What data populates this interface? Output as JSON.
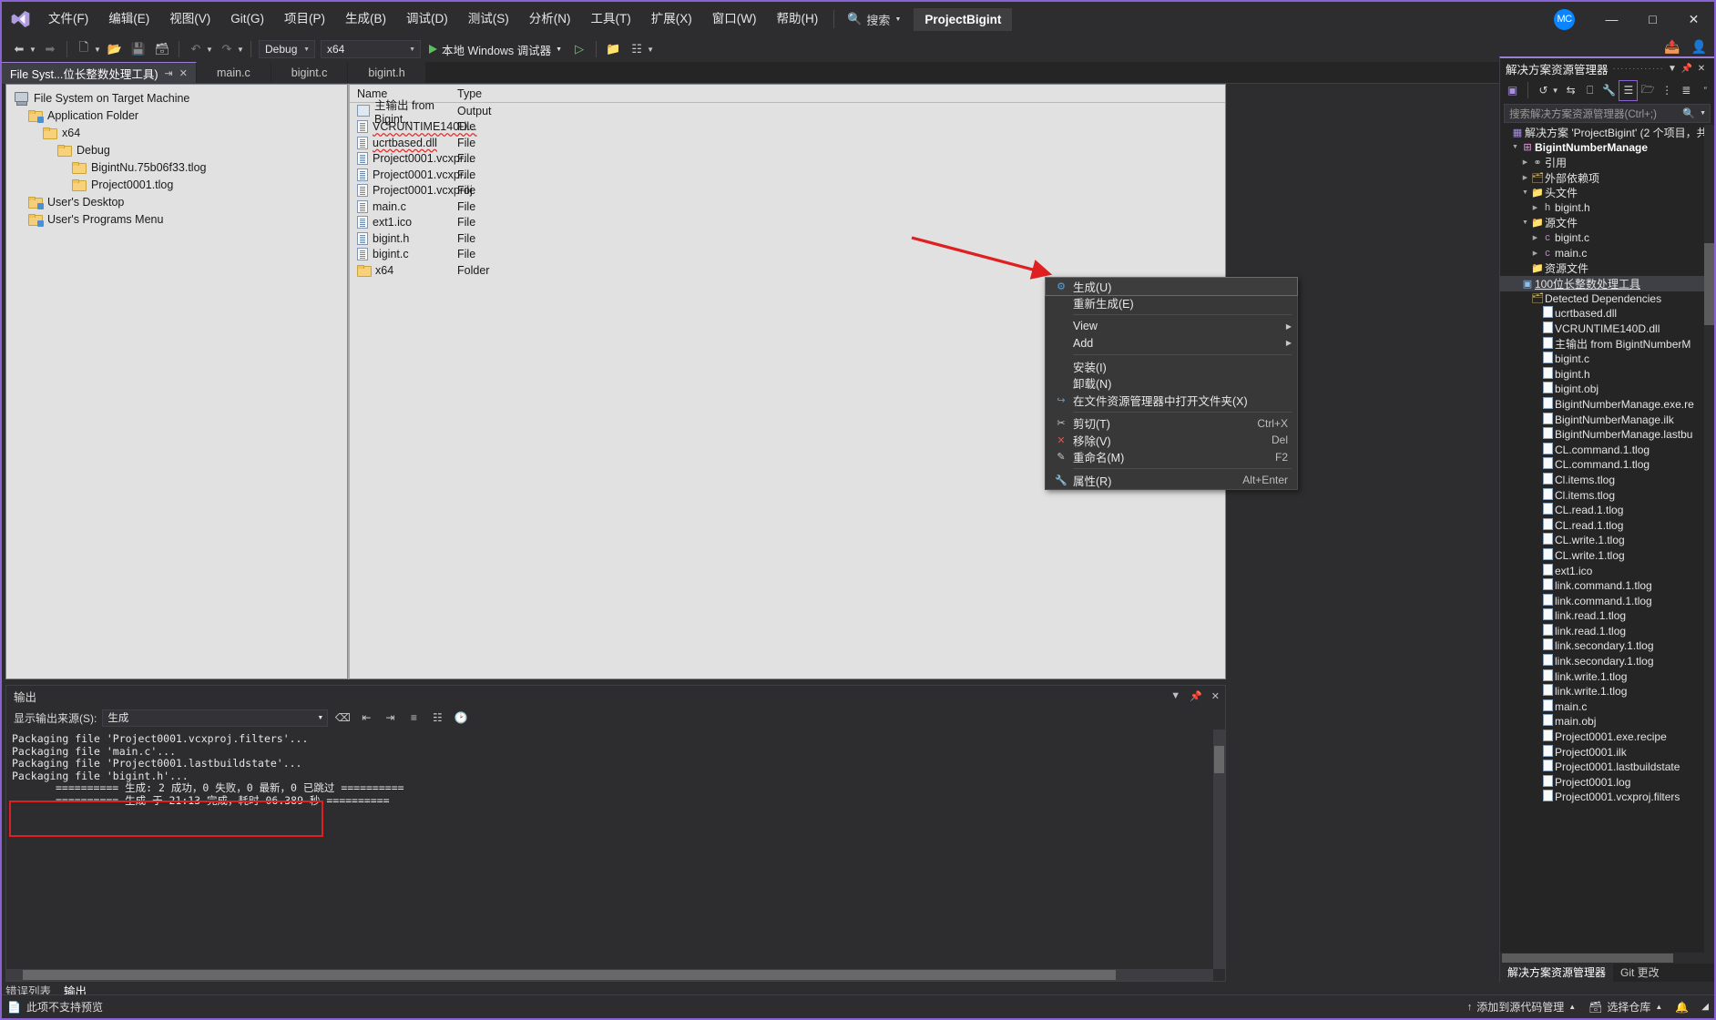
{
  "titlebar": {
    "logo_icon": "visual-studio-logo",
    "menus": [
      "文件(F)",
      "编辑(E)",
      "视图(V)",
      "Git(G)",
      "项目(P)",
      "生成(B)",
      "调试(D)",
      "测试(S)",
      "分析(N)",
      "工具(T)",
      "扩展(X)",
      "窗口(W)",
      "帮助(H)"
    ],
    "search_icon": "search-icon",
    "search_label": "搜索",
    "project_chip": "ProjectBigint",
    "avatar_initials": "MC",
    "minimize": "—",
    "maximize": "□",
    "close": "✕"
  },
  "toolbar": {
    "back_icon": "navigate-back-icon",
    "forward_icon": "navigate-forward-icon",
    "new_project_icon": "new-project-icon",
    "open_icon": "open-file-icon",
    "save_icon": "save-icon",
    "save_all_icon": "save-all-icon",
    "undo_icon": "undo-icon",
    "redo_icon": "redo-icon",
    "config_value": "Debug",
    "platform_value": "x64",
    "run_label": "本地 Windows 调试器",
    "run_icon": "play-icon",
    "attach_icon": "play-outline-icon",
    "folder_icon": "open-folder-icon",
    "layout_icon": "window-layout-icon",
    "share_icon": "share-icon",
    "live_share_icon": "live-share-icon"
  },
  "tabs": [
    {
      "label": "File Syst...位长整数处理工具)",
      "active": true,
      "pin": "⇥",
      "close": "✕"
    },
    {
      "label": "main.c",
      "active": false
    },
    {
      "label": "bigint.c",
      "active": false
    },
    {
      "label": "bigint.h",
      "active": false
    }
  ],
  "tabbar_right": {
    "dropdown_icon": "chevron-down-icon",
    "settings_icon": "gear-icon"
  },
  "designer": {
    "tree": [
      {
        "label": "File System on Target Machine",
        "indent": 0,
        "icon": "computer-icon"
      },
      {
        "label": "Application Folder",
        "indent": 1,
        "icon": "special-folder-icon"
      },
      {
        "label": "x64",
        "indent": 2,
        "icon": "folder-icon"
      },
      {
        "label": "Debug",
        "indent": 3,
        "icon": "folder-icon"
      },
      {
        "label": "BigintNu.75b06f33.tlog",
        "indent": 4,
        "icon": "folder-icon"
      },
      {
        "label": "Project0001.tlog",
        "indent": 4,
        "icon": "folder-icon"
      },
      {
        "label": "User's Desktop",
        "indent": 1,
        "icon": "special-folder-icon"
      },
      {
        "label": "User's Programs Menu",
        "indent": 1,
        "icon": "special-folder-icon"
      }
    ],
    "columns": [
      "Name",
      "Type"
    ],
    "files": [
      {
        "name": "主输出 from Bigint...",
        "type": "Output",
        "icon": "output-icon",
        "squiggle": false
      },
      {
        "name": "VCRUNTIME140D...",
        "type": "File",
        "icon": "file-icon",
        "squiggle": true
      },
      {
        "name": "ucrtbased.dll",
        "type": "File",
        "icon": "file-icon",
        "squiggle": true
      },
      {
        "name": "Project0001.vcxpr...",
        "type": "File",
        "icon": "file-icon",
        "squiggle": false
      },
      {
        "name": "Project0001.vcxpr...",
        "type": "File",
        "icon": "file-icon",
        "squiggle": false
      },
      {
        "name": "Project0001.vcxproj",
        "type": "File",
        "icon": "file-icon",
        "squiggle": false
      },
      {
        "name": "main.c",
        "type": "File",
        "icon": "file-icon",
        "squiggle": false
      },
      {
        "name": "ext1.ico",
        "type": "File",
        "icon": "file-icon",
        "squiggle": false
      },
      {
        "name": "bigint.h",
        "type": "File",
        "icon": "file-icon",
        "squiggle": false
      },
      {
        "name": "bigint.c",
        "type": "File",
        "icon": "file-icon",
        "squiggle": false
      },
      {
        "name": "x64",
        "type": "Folder",
        "icon": "folder-icon",
        "squiggle": false
      }
    ]
  },
  "context_menu": {
    "items": [
      {
        "label": "生成(U)",
        "icon": "build-icon",
        "shortcut": "",
        "submenu": false,
        "selected": true
      },
      {
        "label": "重新生成(E)",
        "icon": "",
        "shortcut": "",
        "submenu": false,
        "selected": false
      },
      {
        "sep": true
      },
      {
        "label": "View",
        "icon": "",
        "shortcut": "",
        "submenu": true,
        "selected": false
      },
      {
        "label": "Add",
        "icon": "",
        "shortcut": "",
        "submenu": true,
        "selected": false
      },
      {
        "sep": true
      },
      {
        "label": "安装(I)",
        "icon": "",
        "shortcut": "",
        "submenu": false,
        "selected": false
      },
      {
        "label": "卸载(N)",
        "icon": "",
        "shortcut": "",
        "submenu": false,
        "selected": false
      },
      {
        "label": "在文件资源管理器中打开文件夹(X)",
        "icon": "open-in-explorer-icon",
        "shortcut": "",
        "submenu": false,
        "selected": false
      },
      {
        "sep": true
      },
      {
        "label": "剪切(T)",
        "icon": "scissors-icon",
        "shortcut": "Ctrl+X",
        "submenu": false,
        "selected": false
      },
      {
        "label": "移除(V)",
        "icon": "remove-x-icon",
        "shortcut": "Del",
        "submenu": false,
        "selected": false
      },
      {
        "label": "重命名(M)",
        "icon": "rename-icon",
        "shortcut": "F2",
        "submenu": false,
        "selected": false
      },
      {
        "sep": true
      },
      {
        "label": "属性(R)",
        "icon": "wrench-icon",
        "shortcut": "Alt+Enter",
        "submenu": false,
        "selected": false
      }
    ]
  },
  "output": {
    "title": "输出",
    "source_label": "显示输出来源(S):",
    "source_value": "生成",
    "toolbar_icons": [
      "clear-all-icon",
      "toggle-wordwrap-icon",
      "toggle-autoscroll-icon",
      "find-icon",
      "settings-icon",
      "clock-icon"
    ],
    "lines": [
      "Packaging file 'Project0001.vcxproj.filters'...",
      "Packaging file 'main.c'...",
      "Packaging file 'Project0001.lastbuildstate'...",
      "Packaging file 'bigint.h'...",
      "========== 生成: 2 成功，0 失败，0 最新，0 已跳过 ==========",
      "========== 生成 于 21:13 完成，耗时 06.389 秒 =========="
    ],
    "highlight_color": "#e02020",
    "panel_tabs": [
      {
        "label": "错误列表",
        "active": false
      },
      {
        "label": "输出",
        "active": true
      }
    ]
  },
  "solution_explorer": {
    "title": "解决方案资源管理器",
    "header_icons": [
      "chevron-down-icon",
      "pin-icon",
      "close-icon"
    ],
    "toolbar_icons": [
      "code-view-icon",
      "pending-changes-icon",
      "sync-icon",
      "collapse-all-icon",
      "properties-icon",
      "show-all-files-icon",
      "new-folder-icon",
      "filter-icon",
      "sort-icon",
      "overflow-icon"
    ],
    "search_placeholder": "搜索解决方案资源管理器(Ctrl+;)",
    "search_icon": "search-icon",
    "tree": [
      {
        "label": "解决方案 'ProjectBigint' (2 个项目，共",
        "indent": 0,
        "icon": "solution-icon",
        "expander": "",
        "bold": false
      },
      {
        "label": "BigintNumberManage",
        "indent": 1,
        "icon": "cpp-project-icon",
        "expander": "▼",
        "bold": true
      },
      {
        "label": "引用",
        "indent": 2,
        "icon": "references-icon",
        "expander": "▶",
        "bold": false
      },
      {
        "label": "外部依赖项",
        "indent": 2,
        "icon": "external-deps-icon",
        "expander": "▶",
        "bold": false
      },
      {
        "label": "头文件",
        "indent": 2,
        "icon": "filter-folder-icon",
        "expander": "▼",
        "bold": false
      },
      {
        "label": "bigint.h",
        "indent": 3,
        "icon": "h-file-icon",
        "expander": "▶",
        "bold": false
      },
      {
        "label": "源文件",
        "indent": 2,
        "icon": "filter-folder-icon",
        "expander": "▼",
        "bold": false
      },
      {
        "label": "bigint.c",
        "indent": 3,
        "icon": "c-file-icon",
        "expander": "▶",
        "bold": false
      },
      {
        "label": "main.c",
        "indent": 3,
        "icon": "c-file-icon",
        "expander": "▶",
        "bold": false
      },
      {
        "label": "资源文件",
        "indent": 2,
        "icon": "filter-folder-icon",
        "expander": "",
        "bold": false
      },
      {
        "label": "100位长整数处理工具",
        "indent": 1,
        "icon": "setup-project-icon",
        "expander": "",
        "bold": false,
        "selected": true
      },
      {
        "label": "Detected Dependencies",
        "indent": 2,
        "icon": "deps-icon",
        "expander": "",
        "bold": false
      },
      {
        "label": "ucrtbased.dll",
        "indent": 3,
        "icon": "file-icon",
        "expander": "",
        "bold": false
      },
      {
        "label": "VCRUNTIME140D.dll",
        "indent": 3,
        "icon": "file-icon",
        "expander": "",
        "bold": false
      },
      {
        "label": "主输出 from BigintNumberM",
        "indent": 3,
        "icon": "file-icon",
        "expander": "",
        "bold": false
      },
      {
        "label": "bigint.c",
        "indent": 3,
        "icon": "file-icon",
        "expander": "",
        "bold": false
      },
      {
        "label": "bigint.h",
        "indent": 3,
        "icon": "file-icon",
        "expander": "",
        "bold": false
      },
      {
        "label": "bigint.obj",
        "indent": 3,
        "icon": "file-icon",
        "expander": "",
        "bold": false
      },
      {
        "label": "BigintNumberManage.exe.re",
        "indent": 3,
        "icon": "file-icon",
        "expander": "",
        "bold": false
      },
      {
        "label": "BigintNumberManage.ilk",
        "indent": 3,
        "icon": "file-icon",
        "expander": "",
        "bold": false
      },
      {
        "label": "BigintNumberManage.lastbu",
        "indent": 3,
        "icon": "file-icon",
        "expander": "",
        "bold": false
      },
      {
        "label": "CL.command.1.tlog",
        "indent": 3,
        "icon": "file-icon",
        "expander": "",
        "bold": false
      },
      {
        "label": "CL.command.1.tlog",
        "indent": 3,
        "icon": "file-icon",
        "expander": "",
        "bold": false
      },
      {
        "label": "Cl.items.tlog",
        "indent": 3,
        "icon": "file-icon",
        "expander": "",
        "bold": false
      },
      {
        "label": "Cl.items.tlog",
        "indent": 3,
        "icon": "file-icon",
        "expander": "",
        "bold": false
      },
      {
        "label": "CL.read.1.tlog",
        "indent": 3,
        "icon": "file-icon",
        "expander": "",
        "bold": false
      },
      {
        "label": "CL.read.1.tlog",
        "indent": 3,
        "icon": "file-icon",
        "expander": "",
        "bold": false
      },
      {
        "label": "CL.write.1.tlog",
        "indent": 3,
        "icon": "file-icon",
        "expander": "",
        "bold": false
      },
      {
        "label": "CL.write.1.tlog",
        "indent": 3,
        "icon": "file-icon",
        "expander": "",
        "bold": false
      },
      {
        "label": "ext1.ico",
        "indent": 3,
        "icon": "file-icon",
        "expander": "",
        "bold": false
      },
      {
        "label": "link.command.1.tlog",
        "indent": 3,
        "icon": "file-icon",
        "expander": "",
        "bold": false
      },
      {
        "label": "link.command.1.tlog",
        "indent": 3,
        "icon": "file-icon",
        "expander": "",
        "bold": false
      },
      {
        "label": "link.read.1.tlog",
        "indent": 3,
        "icon": "file-icon",
        "expander": "",
        "bold": false
      },
      {
        "label": "link.read.1.tlog",
        "indent": 3,
        "icon": "file-icon",
        "expander": "",
        "bold": false
      },
      {
        "label": "link.secondary.1.tlog",
        "indent": 3,
        "icon": "file-icon",
        "expander": "",
        "bold": false
      },
      {
        "label": "link.secondary.1.tlog",
        "indent": 3,
        "icon": "file-icon",
        "expander": "",
        "bold": false
      },
      {
        "label": "link.write.1.tlog",
        "indent": 3,
        "icon": "file-icon",
        "expander": "",
        "bold": false
      },
      {
        "label": "link.write.1.tlog",
        "indent": 3,
        "icon": "file-icon",
        "expander": "",
        "bold": false
      },
      {
        "label": "main.c",
        "indent": 3,
        "icon": "file-icon",
        "expander": "",
        "bold": false
      },
      {
        "label": "main.obj",
        "indent": 3,
        "icon": "file-icon",
        "expander": "",
        "bold": false
      },
      {
        "label": "Project0001.exe.recipe",
        "indent": 3,
        "icon": "file-icon",
        "expander": "",
        "bold": false
      },
      {
        "label": "Project0001.ilk",
        "indent": 3,
        "icon": "file-icon",
        "expander": "",
        "bold": false
      },
      {
        "label": "Project0001.lastbuildstate",
        "indent": 3,
        "icon": "file-icon",
        "expander": "",
        "bold": false
      },
      {
        "label": "Project0001.log",
        "indent": 3,
        "icon": "file-icon",
        "expander": "",
        "bold": false
      },
      {
        "label": "Project0001.vcxproj.filters",
        "indent": 3,
        "icon": "file-icon",
        "expander": "",
        "bold": false
      }
    ],
    "footer_tabs": [
      {
        "label": "解决方案资源管理器",
        "active": true
      },
      {
        "label": "Git 更改",
        "active": false
      }
    ]
  },
  "statusbar": {
    "left_icon": "no-preview-icon",
    "left_text": "此项不支持预览",
    "source_control_icon": "arrow-up-icon",
    "source_control_text": "添加到源代码管理",
    "source_control_caret": "▲",
    "repo_icon": "repo-icon",
    "repo_text": "选择仓库",
    "repo_caret": "▲",
    "bell_icon": "notifications-icon",
    "resize_icon": "resize-grip-icon"
  }
}
